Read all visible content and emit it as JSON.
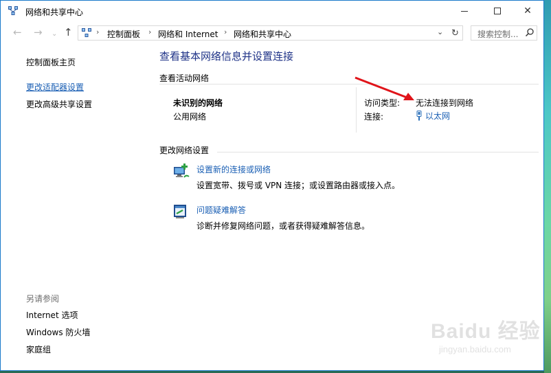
{
  "window": {
    "title": "网络和共享中心"
  },
  "navbar": {
    "breadcrumbs": [
      "控制面板",
      "网络和 Internet",
      "网络和共享中心"
    ],
    "search_placeholder": "搜索控制..."
  },
  "sidebar": {
    "items": [
      {
        "label": "控制面板主页"
      },
      {
        "label": "更改适配器设置"
      },
      {
        "label": "更改高级共享设置"
      }
    ],
    "see_also_label": "另请参阅",
    "see_also_items": [
      {
        "label": "Internet 选项"
      },
      {
        "label": "Windows 防火墙"
      },
      {
        "label": "家庭组"
      }
    ]
  },
  "main": {
    "title": "查看基本网络信息并设置连接",
    "active_networks_heading": "查看活动网络",
    "network_name": "未识别的网络",
    "network_type": "公用网络",
    "access_type_label": "访问类型:",
    "access_type_value": "无法连接到网络",
    "connection_label": "连接:",
    "connection_value": "以太网",
    "change_settings_heading": "更改网络设置",
    "tasks": [
      {
        "link": "设置新的连接或网络",
        "desc": "设置宽带、拨号或 VPN 连接；或设置路由器或接入点。",
        "icon": "new-connection-icon"
      },
      {
        "link": "问题疑难解答",
        "desc": "诊断并修复网络问题，或者获得疑难解答信息。",
        "icon": "troubleshoot-icon"
      }
    ]
  },
  "watermark": {
    "brand": "Baidu 经验",
    "url": "jingyan.baidu.com"
  },
  "colors": {
    "link": "#1a5fb4",
    "title": "#1e3287",
    "annotation_arrow": "#e0141a"
  }
}
